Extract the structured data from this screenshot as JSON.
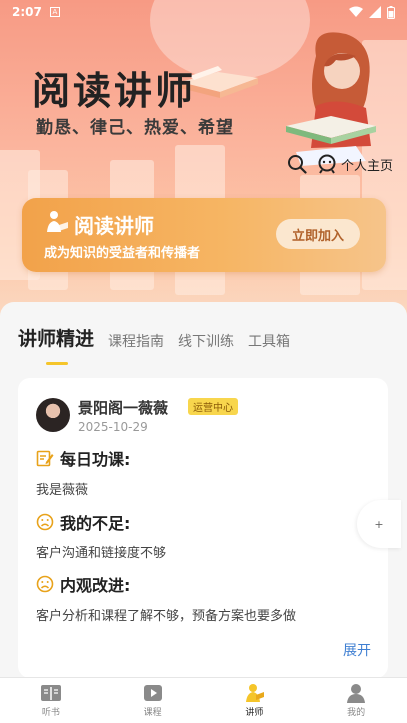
{
  "status_bar": {
    "time": "2:07"
  },
  "hero": {
    "title": "阅读讲师",
    "slogan": "勤恳、律己、热爱、希望",
    "profile_label": "个人主页"
  },
  "banner": {
    "title": "阅读讲师",
    "subtitle": "成为知识的受益者和传播者",
    "join_label": "立即加入"
  },
  "tabs": [
    {
      "label": "讲师精进",
      "active": true
    },
    {
      "label": "课程指南",
      "active": false
    },
    {
      "label": "线下训练",
      "active": false
    },
    {
      "label": "工具箱",
      "active": false
    }
  ],
  "post": {
    "author": "景阳阁一薇薇",
    "role_tag": "运营中心",
    "date": "2025-10-29",
    "sections": [
      {
        "title": "每日功课:",
        "text": "我是薇薇",
        "icon": "edit-icon"
      },
      {
        "title": "我的不足:",
        "text": "客户沟通和链接度不够",
        "icon": "sad-face-icon"
      },
      {
        "title": "内观改进:",
        "text": "客户分析和课程了解不够，预备方案也要多做",
        "icon": "sad-face-icon"
      }
    ],
    "expand_label": "展开"
  },
  "side_button": {
    "label": "+"
  },
  "bottom_nav": [
    {
      "label": "听书",
      "icon": "book-icon",
      "active": false
    },
    {
      "label": "课程",
      "icon": "play-icon",
      "active": false
    },
    {
      "label": "讲师",
      "icon": "lecturer-icon",
      "active": true
    },
    {
      "label": "我的",
      "icon": "user-icon",
      "active": false
    }
  ],
  "colors": {
    "accent": "#f5c52a",
    "banner": "#f2a24a",
    "link": "#3f7fd2"
  }
}
